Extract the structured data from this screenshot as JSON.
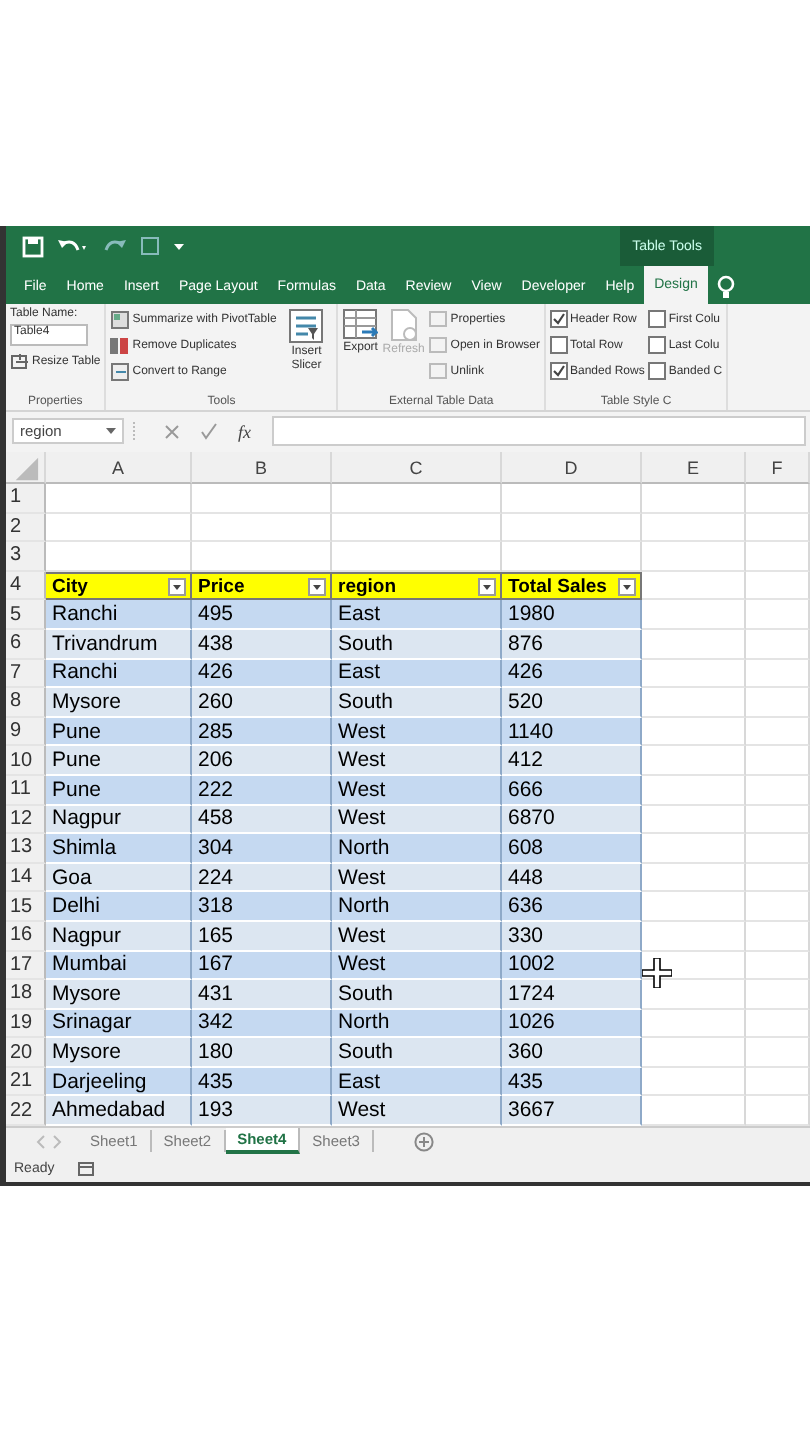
{
  "title_bar": {
    "context_label": "Table Tools"
  },
  "tabs": [
    {
      "label": "File",
      "selected": false
    },
    {
      "label": "Home",
      "selected": false
    },
    {
      "label": "Insert",
      "selected": false
    },
    {
      "label": "Page Layout",
      "selected": false
    },
    {
      "label": "Formulas",
      "selected": false
    },
    {
      "label": "Data",
      "selected": false
    },
    {
      "label": "Review",
      "selected": false
    },
    {
      "label": "View",
      "selected": false
    },
    {
      "label": "Developer",
      "selected": false
    },
    {
      "label": "Help",
      "selected": false
    },
    {
      "label": "Design",
      "selected": true
    }
  ],
  "ribbon": {
    "properties": {
      "name_label": "Table Name:",
      "table_name": "Table4",
      "resize": "Resize Table",
      "group_label": "Properties"
    },
    "tools": {
      "items": [
        "Summarize with PivotTable",
        "Remove Duplicates",
        "Convert to Range"
      ],
      "slicer": "Insert Slicer",
      "group_label": "Tools"
    },
    "external": {
      "export": "Export",
      "refresh": {
        "label": "Refresh",
        "disabled": true
      },
      "items": [
        {
          "label": "Properties",
          "disabled": true
        },
        {
          "label": "Open in Browser",
          "disabled": true
        },
        {
          "label": "Unlink",
          "disabled": true
        }
      ],
      "group_label": "External Table Data"
    },
    "style_options": {
      "options": [
        {
          "label": "Header Row",
          "checked": true
        },
        {
          "label": "Total Row",
          "checked": false
        },
        {
          "label": "Banded Rows",
          "checked": true
        },
        {
          "label": "First Colu",
          "checked": false
        },
        {
          "label": "Last Colu",
          "checked": false
        },
        {
          "label": "Banded C",
          "checked": false
        }
      ],
      "group_label": "Table Style C"
    }
  },
  "formula_bar": {
    "name_box": "region",
    "fx": "fx"
  },
  "sheet": {
    "columns": [
      "A",
      "B",
      "C",
      "D",
      "E",
      "F"
    ],
    "blank_rows": [
      "1",
      "2",
      "3"
    ],
    "table": {
      "header_row": "4",
      "headers": [
        "City",
        "Price",
        "region",
        "Total Sales"
      ],
      "rows": [
        {
          "number": "5",
          "cells": [
            "Ranchi",
            "495",
            "East",
            "1980"
          ]
        },
        {
          "number": "6",
          "cells": [
            "Trivandrum",
            "438",
            "South",
            "876"
          ]
        },
        {
          "number": "7",
          "cells": [
            "Ranchi",
            "426",
            "East",
            "426"
          ]
        },
        {
          "number": "8",
          "cells": [
            "Mysore",
            "260",
            "South",
            "520"
          ]
        },
        {
          "number": "9",
          "cells": [
            "Pune",
            "285",
            "West",
            "1140"
          ]
        },
        {
          "number": "10",
          "cells": [
            "Pune",
            "206",
            "West",
            "412"
          ]
        },
        {
          "number": "11",
          "cells": [
            "Pune",
            "222",
            "West",
            "666"
          ]
        },
        {
          "number": "12",
          "cells": [
            "Nagpur",
            "458",
            "West",
            "6870"
          ]
        },
        {
          "number": "13",
          "cells": [
            "Shimla",
            "304",
            "North",
            "608"
          ]
        },
        {
          "number": "14",
          "cells": [
            "Goa",
            "224",
            "West",
            "448"
          ]
        },
        {
          "number": "15",
          "cells": [
            "Delhi",
            "318",
            "North",
            "636"
          ]
        },
        {
          "number": "16",
          "cells": [
            "Nagpur",
            "165",
            "West",
            "330"
          ]
        },
        {
          "number": "17",
          "cells": [
            "Mumbai",
            "167",
            "West",
            "1002"
          ]
        },
        {
          "number": "18",
          "cells": [
            "Mysore",
            "431",
            "South",
            "1724"
          ]
        },
        {
          "number": "19",
          "cells": [
            "Srinagar",
            "342",
            "North",
            "1026"
          ]
        },
        {
          "number": "20",
          "cells": [
            "Mysore",
            "180",
            "South",
            "360"
          ]
        },
        {
          "number": "21",
          "cells": [
            "Darjeeling",
            "435",
            "East",
            "435"
          ]
        },
        {
          "number": "22",
          "cells": [
            "Ahmedabad",
            "193",
            "West",
            "3667"
          ]
        }
      ]
    }
  },
  "sheet_tabs": [
    {
      "label": "Sheet1",
      "selected": false
    },
    {
      "label": "Sheet2",
      "selected": false
    },
    {
      "label": "Sheet4",
      "selected": true
    },
    {
      "label": "Sheet3",
      "selected": false
    }
  ],
  "status_bar": {
    "text": "Ready"
  }
}
